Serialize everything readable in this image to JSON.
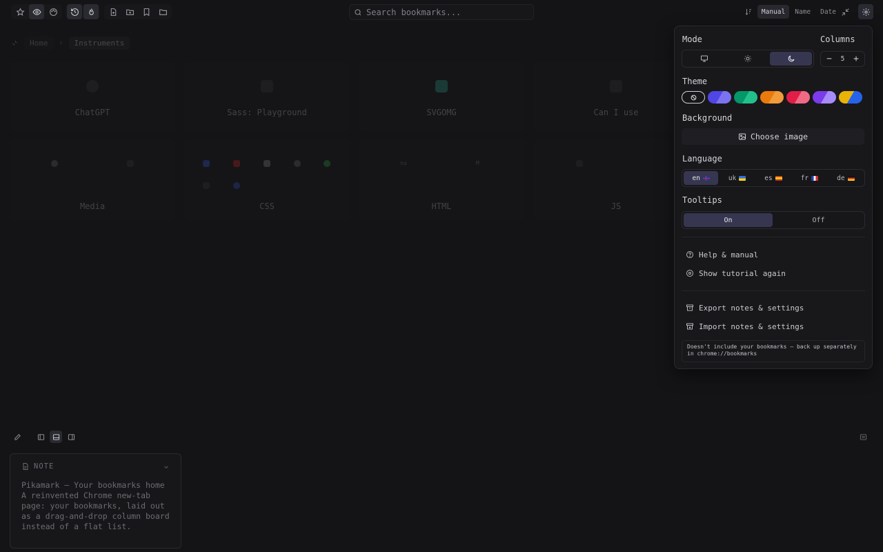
{
  "topbar": {
    "search": {
      "placeholder": "Search bookmarks..."
    },
    "sort": {
      "options": [
        "Manual",
        "Name",
        "Date"
      ],
      "active": "Manual"
    }
  },
  "breadcrumb": [
    "Home",
    "Instruments"
  ],
  "cards": [
    {
      "title": "ChatGPT"
    },
    {
      "title": "Sass: Playground"
    },
    {
      "title": "SVGOMG"
    },
    {
      "title": "Can I use"
    },
    {
      "title": "Media"
    },
    {
      "title": "CSS"
    },
    {
      "title": "HTML"
    },
    {
      "title": "JS"
    }
  ],
  "card_mini_labels": {
    "html_a": "nu",
    "html_b": "M"
  },
  "note": {
    "header": "NOTE",
    "lines": [
      "Pikamark — Your bookmarks home",
      "A reinvented Chrome new-tab",
      "page: your bookmarks, laid out",
      "as a drag-and-drop column board",
      "instead of a flat list."
    ]
  },
  "settings": {
    "mode_label": "Mode",
    "columns_label": "Columns",
    "columns_value": "5",
    "mode_options": [
      "monitor-icon",
      "sun-icon",
      "moon-icon"
    ],
    "mode_active": "moon-icon",
    "theme_label": "Theme",
    "theme_swatches": [
      {
        "name": "none",
        "a": "",
        "b": ""
      },
      {
        "name": "indigo",
        "a": "#4f46e5",
        "b": "#7c73f0"
      },
      {
        "name": "green",
        "a": "#059669",
        "b": "#22c08a"
      },
      {
        "name": "orange",
        "a": "#ea7a0c",
        "b": "#f29b3a"
      },
      {
        "name": "rose",
        "a": "#e11d48",
        "b": "#f06a86"
      },
      {
        "name": "violet",
        "a": "#7c3aed",
        "b": "#a78bfa"
      },
      {
        "name": "yellow-blue",
        "a": "#eab308",
        "b": "#2563eb"
      }
    ],
    "background_label": "Background",
    "choose_image": "Choose image",
    "language_label": "Language",
    "languages": [
      "en",
      "uk",
      "es",
      "fr",
      "de"
    ],
    "language_active": "en",
    "tooltips_label": "Tooltips",
    "tooltips_on": "On",
    "tooltips_off": "Off",
    "help": "Help & manual",
    "tutorial": "Show tutorial again",
    "export": "Export notes & settings",
    "import": "Import notes & settings",
    "hint": "Doesn't include your bookmarks — back up separately in chrome://bookmarks"
  },
  "colors": {
    "accent": "#363650",
    "bg": "#141416"
  }
}
